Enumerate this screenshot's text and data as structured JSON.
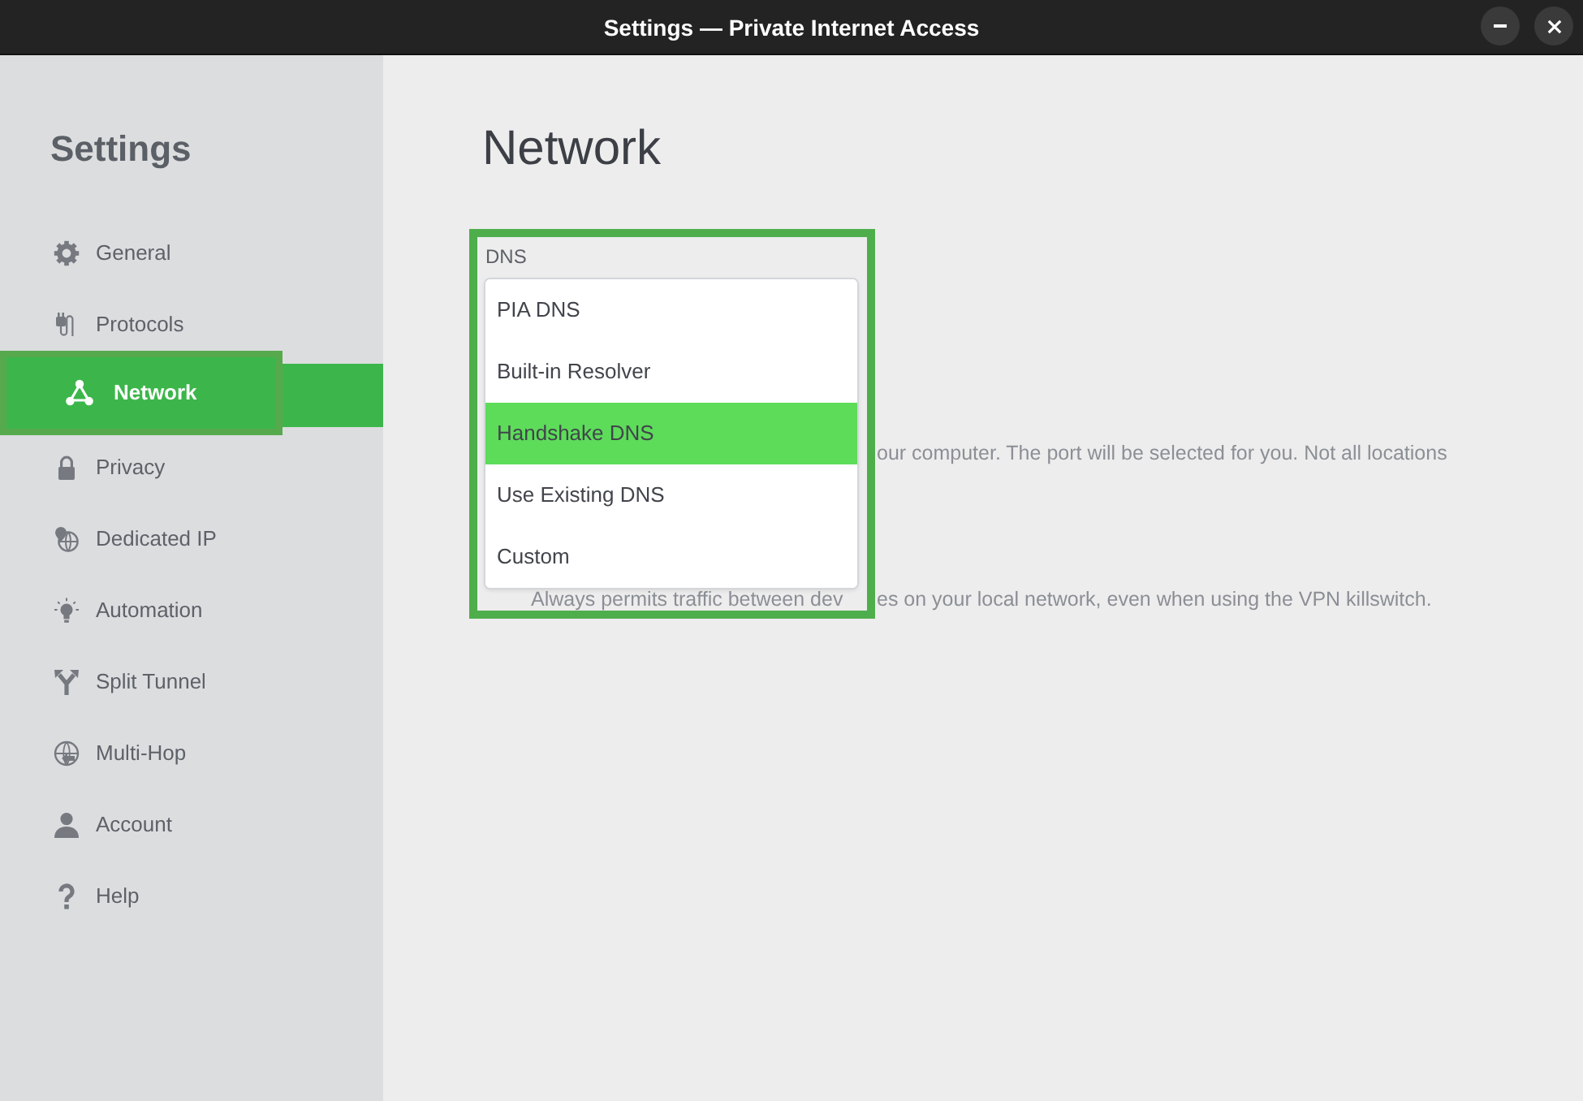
{
  "window": {
    "title": "Settings — Private Internet Access"
  },
  "sidebar": {
    "title": "Settings",
    "items": [
      {
        "label": "General",
        "selected": false,
        "focused": false
      },
      {
        "label": "Protocols",
        "selected": false,
        "focused": false
      },
      {
        "label": "Network",
        "selected": true,
        "focused": true
      },
      {
        "label": "Privacy",
        "selected": false,
        "focused": false
      },
      {
        "label": "Dedicated IP",
        "selected": false,
        "focused": false
      },
      {
        "label": "Automation",
        "selected": false,
        "focused": false
      },
      {
        "label": "Split Tunnel",
        "selected": false,
        "focused": false
      },
      {
        "label": "Multi-Hop",
        "selected": false,
        "focused": false
      },
      {
        "label": "Account",
        "selected": false,
        "focused": false
      },
      {
        "label": "Help",
        "selected": false,
        "focused": false
      }
    ]
  },
  "page": {
    "title": "Network",
    "dns": {
      "label": "DNS",
      "focused": true,
      "options": [
        {
          "label": "PIA DNS",
          "selected": false
        },
        {
          "label": "Built-in Resolver",
          "selected": false
        },
        {
          "label": "Handshake DNS",
          "selected": true
        },
        {
          "label": "Use Existing DNS",
          "selected": false
        },
        {
          "label": "Custom",
          "selected": false
        }
      ]
    },
    "lines_behind_popup": [
      {
        "right": "our computer. The port will be selected for you. Not all locations"
      },
      {
        "left": "Always permits traffic between dev",
        "right": "es on your local network, even when using the VPN killswitch."
      }
    ]
  }
}
